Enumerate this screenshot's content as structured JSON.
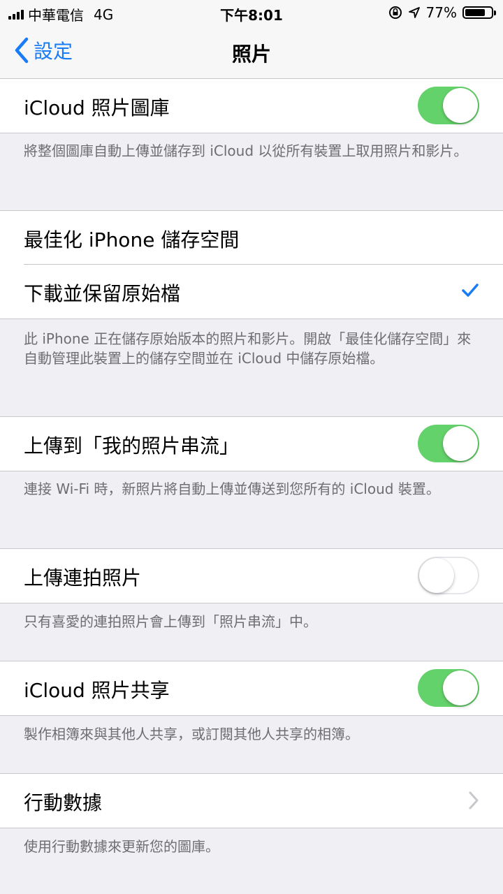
{
  "status_bar": {
    "carrier": "中華電信",
    "network": "4G",
    "time": "下午8:01",
    "battery_percent": "77%",
    "battery_level": 0.77
  },
  "nav": {
    "back_label": "設定",
    "title": "照片"
  },
  "settings": {
    "icloud_library": {
      "label": "iCloud 照片圖庫",
      "on": true,
      "footer": "將整個圖庫自動上傳並儲存到 iCloud 以從所有裝置上取用照片和影片。"
    },
    "storage": {
      "optimize_label": "最佳化 iPhone 儲存空間",
      "download_label": "下載並保留原始檔",
      "selected": "download",
      "footer": "此 iPhone 正在儲存原始版本的照片和影片。開啟「最佳化儲存空間」來自動管理此裝置上的儲存空間並在 iCloud 中儲存原始檔。"
    },
    "photo_stream": {
      "label": "上傳到「我的照片串流」",
      "on": true,
      "footer": "連接 Wi-Fi 時，新照片將自動上傳並傳送到您所有的 iCloud 裝置。"
    },
    "burst": {
      "label": "上傳連拍照片",
      "on": false,
      "footer": "只有喜愛的連拍照片會上傳到「照片串流」中。"
    },
    "sharing": {
      "label": "iCloud 照片共享",
      "on": true,
      "footer": "製作相簿來與其他人共享，或訂閱其他人共享的相簿。"
    },
    "cellular": {
      "label": "行動數據",
      "footer": "使用行動數據來更新您的圖庫。"
    }
  },
  "colors": {
    "accent": "#1a7cf5",
    "toggle_on": "#64d26a",
    "background": "#efeff4"
  }
}
